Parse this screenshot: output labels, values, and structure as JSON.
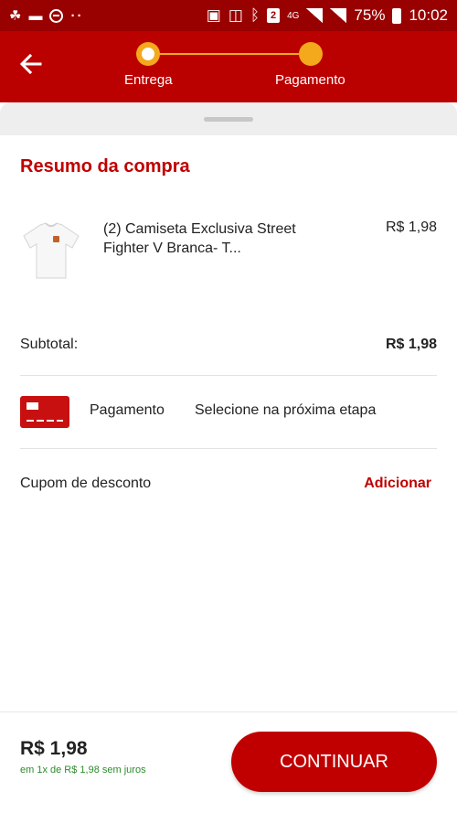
{
  "status_bar": {
    "battery": "75%",
    "time": "10:02",
    "network": "4G",
    "sim": "2",
    "dots": "··"
  },
  "header": {
    "steps": [
      {
        "label": "Entrega",
        "state": "done"
      },
      {
        "label": "Pagamento",
        "state": "current"
      }
    ],
    "colors": {
      "primary": "#bb0000",
      "accent": "#f4a81c"
    }
  },
  "summary": {
    "title": "Resumo da compra",
    "product": {
      "name": "(2) Camiseta Exclusiva Street Fighter V Branca- T...",
      "price": "R$ 1,98"
    },
    "subtotal_label": "Subtotal:",
    "subtotal_value": "R$ 1,98",
    "payment_label": "Pagamento",
    "payment_value": "Selecione na próxima etapa",
    "coupon_label": "Cupom de desconto",
    "coupon_action": "Adicionar"
  },
  "footer": {
    "total": "R$ 1,98",
    "installments": "em 1x de R$ 1,98 sem juros",
    "continue_label": "CONTINUAR"
  }
}
